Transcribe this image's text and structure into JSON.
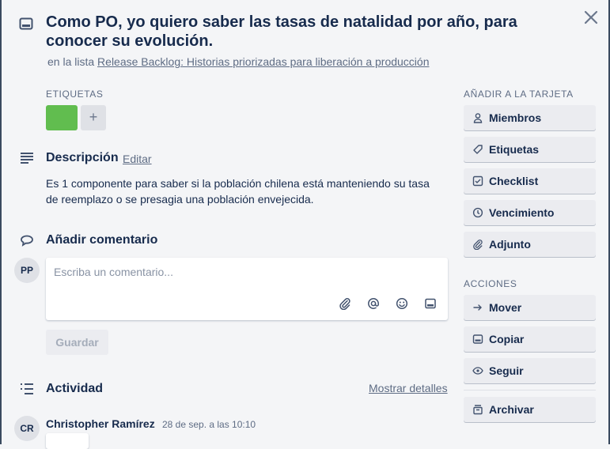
{
  "card": {
    "title": "Como PO, yo quiero saber las tasas de natalidad por año, para conocer su evolución.",
    "in_list_prefix": "en la lista",
    "list_name": "Release Backlog: Historias priorizadas para liberación a producción"
  },
  "labels": {
    "heading": "ETIQUETAS",
    "chip_color": "#61bd4f",
    "add_glyph": "+"
  },
  "description": {
    "heading": "Descripción",
    "edit_label": "Editar",
    "text": "Es 1 componente para saber si la población chilena está manteniendo su tasa de reemplazo o se presagia una población envejecida."
  },
  "comment": {
    "heading": "Añadir comentario",
    "avatar_initials": "PP",
    "placeholder": "Escriba un comentario...",
    "save_label": "Guardar",
    "icons": [
      "paperclip-icon",
      "at-sign-icon",
      "emoji-icon",
      "card-icon"
    ]
  },
  "activity": {
    "heading": "Actividad",
    "show_details_label": "Mostrar detalles",
    "items": [
      {
        "initials": "CR",
        "author": "Christopher Ramírez",
        "time": "28 de sep. a las 10:10"
      }
    ]
  },
  "sidebar": {
    "add_heading": "AÑADIR A LA TARJETA",
    "add_items": [
      {
        "label": "Miembros",
        "icon": "person-icon"
      },
      {
        "label": "Etiquetas",
        "icon": "tag-icon"
      },
      {
        "label": "Checklist",
        "icon": "checklist-icon"
      },
      {
        "label": "Vencimiento",
        "icon": "clock-icon"
      },
      {
        "label": "Adjunto",
        "icon": "paperclip-icon"
      }
    ],
    "actions_heading": "ACCIONES",
    "action_items": [
      {
        "label": "Mover",
        "icon": "arrow-right-icon"
      },
      {
        "label": "Copiar",
        "icon": "card-icon"
      },
      {
        "label": "Seguir",
        "icon": "eye-icon"
      },
      {
        "label": "Archivar",
        "icon": "archive-icon"
      }
    ]
  },
  "colors": {
    "background": "#f4f5f7",
    "text": "#172b4d",
    "muted": "#5e6c84",
    "button_bg": "#ebecf0",
    "label_green": "#61bd4f"
  }
}
